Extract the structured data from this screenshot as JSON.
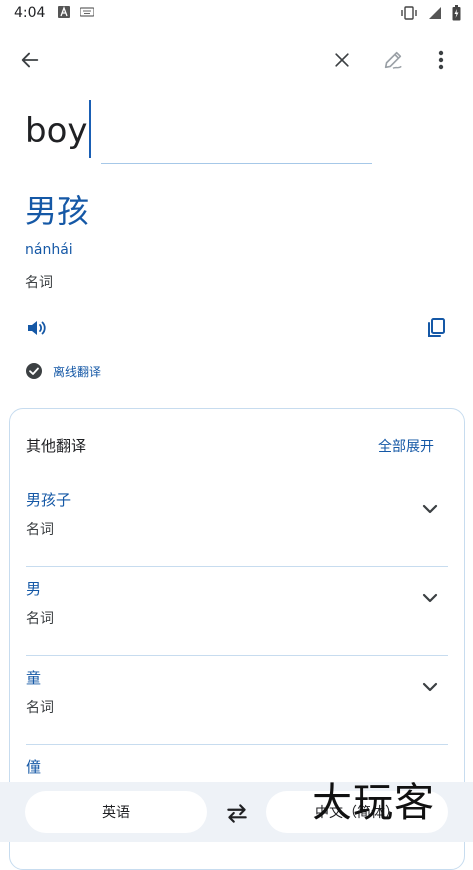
{
  "status_bar": {
    "time": "4:04"
  },
  "toolbar": {
    "back": "back-arrow-icon",
    "clear": "close-icon",
    "handwrite": "pen-icon",
    "more": "more-vert-icon"
  },
  "source": {
    "text": "boy"
  },
  "result": {
    "translation": "男孩",
    "pinyin": "nánhái",
    "pos": "名词",
    "offline_label": "离线翻译"
  },
  "other": {
    "title": "其他翻译",
    "expand_all": "全部展开",
    "items": [
      {
        "word": "男孩子",
        "pos": "名词"
      },
      {
        "word": "男",
        "pos": "名词"
      },
      {
        "word": "童",
        "pos": "名词"
      },
      {
        "word": "僮",
        "pos": ""
      }
    ]
  },
  "bottom": {
    "source_lang": "英语",
    "target_lang": "中文（简体）"
  },
  "watermark": {
    "text": "大玩客"
  },
  "colors": {
    "accent": "#1558a6",
    "divider": "#c7dcef"
  }
}
